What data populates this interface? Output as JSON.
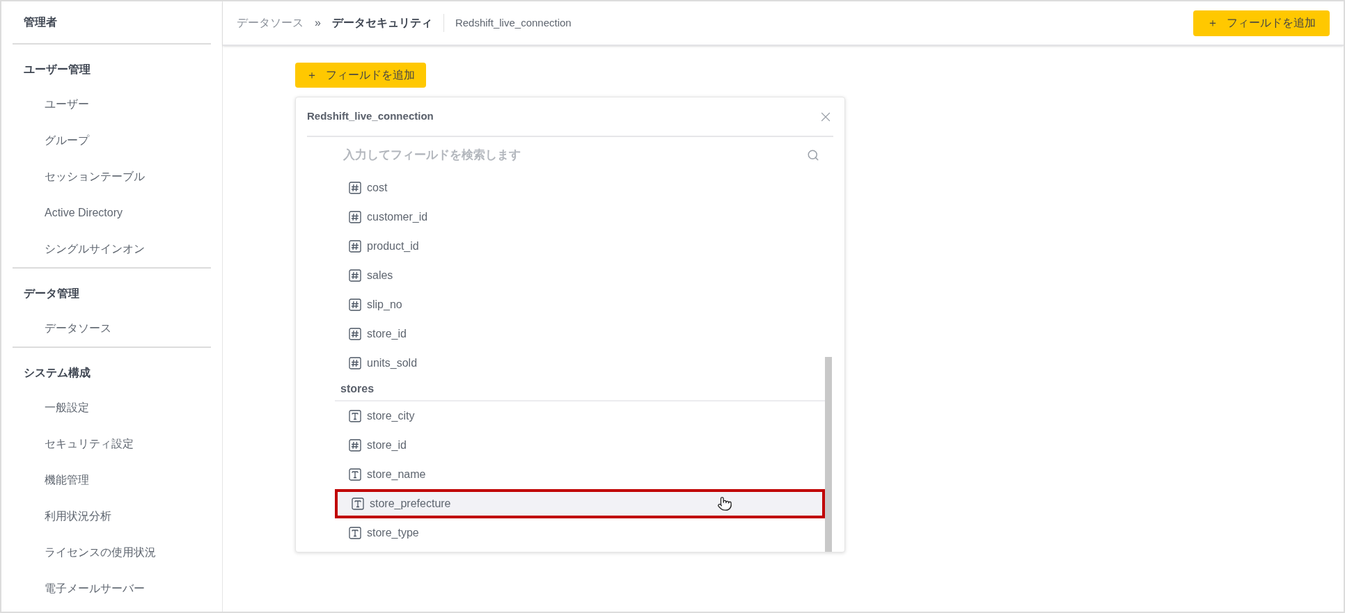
{
  "sidebar": {
    "title": "管理者",
    "sections": [
      {
        "heading": "ユーザー管理",
        "items": [
          "ユーザー",
          "グループ",
          "セッションテーブル",
          "Active Directory",
          "シングルサインオン"
        ]
      },
      {
        "heading": "データ管理",
        "items": [
          "データソース"
        ]
      },
      {
        "heading": "システム構成",
        "items": [
          "一般設定",
          "セキュリティ設定",
          "機能管理",
          "利用状況分析",
          "ライセンスの使用状況",
          "電子メールサーバー"
        ]
      }
    ]
  },
  "breadcrumb": {
    "parent": "データソース",
    "separator": "»",
    "current": "データセキュリティ",
    "connection": "Redshift_live_connection"
  },
  "header_button": {
    "icon": "＋",
    "label": "フィールドを追加"
  },
  "add_field_button": {
    "icon": "＋",
    "label": "フィールドを追加"
  },
  "panel": {
    "title": "Redshift_live_connection",
    "search": {
      "placeholder": "入力してフィールドを検索します"
    },
    "groups": [
      {
        "fields": [
          {
            "name": "cost",
            "kind": "number",
            "selected": false
          },
          {
            "name": "customer_id",
            "kind": "number",
            "selected": false
          },
          {
            "name": "product_id",
            "kind": "number",
            "selected": false
          },
          {
            "name": "sales",
            "kind": "number",
            "selected": false
          },
          {
            "name": "slip_no",
            "kind": "number",
            "selected": false
          },
          {
            "name": "store_id",
            "kind": "number",
            "selected": false
          },
          {
            "name": "units_sold",
            "kind": "number",
            "selected": false
          }
        ]
      },
      {
        "name": "stores",
        "fields": [
          {
            "name": "store_city",
            "kind": "text",
            "selected": false
          },
          {
            "name": "store_id",
            "kind": "number",
            "selected": false
          },
          {
            "name": "store_name",
            "kind": "text",
            "selected": false
          },
          {
            "name": "store_prefecture",
            "kind": "text",
            "selected": true
          },
          {
            "name": "store_type",
            "kind": "text",
            "selected": false
          }
        ]
      }
    ]
  }
}
